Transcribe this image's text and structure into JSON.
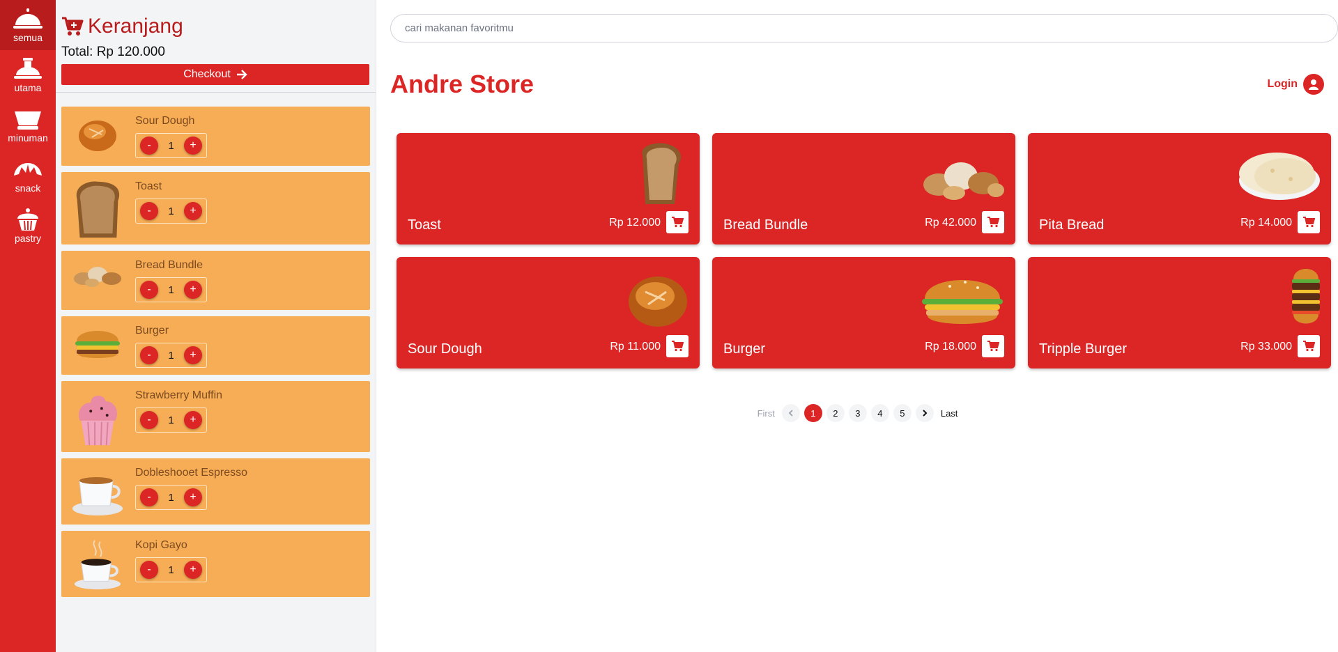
{
  "categories": [
    {
      "label": "semua",
      "icon": "cloche-icon",
      "active": true
    },
    {
      "label": "utama",
      "icon": "main-dish-icon",
      "active": false
    },
    {
      "label": "minuman",
      "icon": "drink-bowl-icon",
      "active": false
    },
    {
      "label": "snack",
      "icon": "croissant-icon",
      "active": false
    },
    {
      "label": "pastry",
      "icon": "cupcake-icon",
      "active": false
    }
  ],
  "cart": {
    "title": "Keranjang",
    "total": "Total: Rp 120.000",
    "checkout_label": "Checkout",
    "items": [
      {
        "name": "Sour Dough",
        "qty": "1",
        "minus": "-",
        "plus": "+"
      },
      {
        "name": "Toast",
        "qty": "1",
        "minus": "-",
        "plus": "+"
      },
      {
        "name": "Bread Bundle",
        "qty": "1",
        "minus": "-",
        "plus": "+"
      },
      {
        "name": "Burger",
        "qty": "1",
        "minus": "-",
        "plus": "+"
      },
      {
        "name": "Strawberry Muffin",
        "qty": "1",
        "minus": "-",
        "plus": "+"
      },
      {
        "name": "Dobleshooet Espresso",
        "qty": "1",
        "minus": "-",
        "plus": "+"
      },
      {
        "name": "Kopi Gayo",
        "qty": "1",
        "minus": "-",
        "plus": "+"
      }
    ]
  },
  "search": {
    "placeholder": "cari makanan favoritmu"
  },
  "store": {
    "title": "Andre Store",
    "login_label": "Login"
  },
  "products": [
    {
      "name": "Toast",
      "price": "Rp 12.000"
    },
    {
      "name": "Bread Bundle",
      "price": "Rp 42.000"
    },
    {
      "name": "Pita Bread",
      "price": "Rp 14.000"
    },
    {
      "name": "Sour Dough",
      "price": "Rp 11.000"
    },
    {
      "name": "Burger",
      "price": "Rp 18.000"
    },
    {
      "name": "Tripple Burger",
      "price": "Rp 33.000"
    }
  ],
  "pagination": {
    "first": "First",
    "last": "Last",
    "pages": [
      "1",
      "2",
      "3",
      "4",
      "5"
    ],
    "current": "1"
  },
  "colors": {
    "primary": "#dc2626",
    "cart_item": "#f6ad55",
    "panel": "#f3f4f6"
  }
}
